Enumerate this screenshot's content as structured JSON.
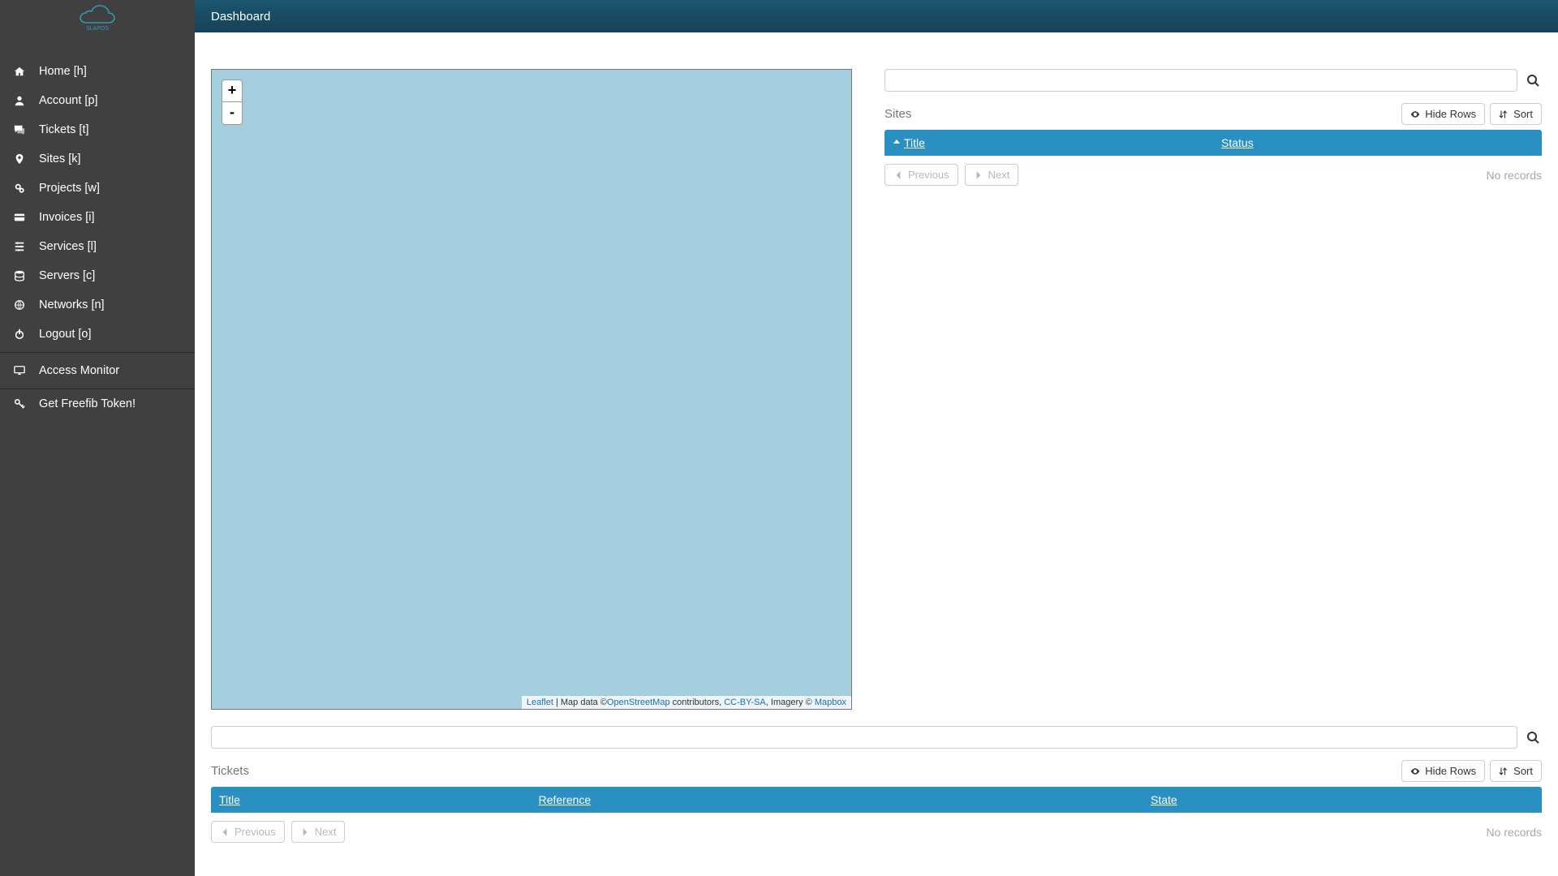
{
  "brand": "SLAPOS",
  "header": {
    "title": "Dashboard"
  },
  "sidebar": {
    "items": [
      {
        "label": "Home [h]",
        "icon": "home-icon"
      },
      {
        "label": "Account [p]",
        "icon": "user-icon"
      },
      {
        "label": "Tickets [t]",
        "icon": "comments-icon"
      },
      {
        "label": "Sites [k]",
        "icon": "marker-icon"
      },
      {
        "label": "Projects [w]",
        "icon": "gears-icon"
      },
      {
        "label": "Invoices [i]",
        "icon": "card-icon"
      },
      {
        "label": "Services [l]",
        "icon": "sliders-icon"
      },
      {
        "label": "Servers [c]",
        "icon": "database-icon"
      },
      {
        "label": "Networks [n]",
        "icon": "globe-icon"
      },
      {
        "label": "Logout [o]",
        "icon": "power-icon"
      }
    ],
    "monitor": {
      "label": "Access Monitor",
      "icon": "monitor-icon"
    },
    "token": {
      "label": "Get Freefib Token!",
      "icon": "key-icon"
    }
  },
  "map": {
    "zoom_in": "+",
    "zoom_out": "-",
    "attribution": {
      "leaflet": "Leaflet",
      "prefix": " | Map data ©",
      "osm": "OpenStreetMap",
      "contrib": " contributors, ",
      "cc": "CC-BY-SA",
      "imagery": ", Imagery © ",
      "mapbox": "Mapbox"
    }
  },
  "buttons": {
    "hide_rows": "Hide Rows",
    "sort": "Sort",
    "previous": "Previous",
    "next": "Next"
  },
  "sites": {
    "title": "Sites",
    "columns": {
      "title": "Title",
      "status": "Status"
    },
    "empty": "No records",
    "search_placeholder": ""
  },
  "tickets": {
    "title": "Tickets",
    "columns": {
      "title": "Title",
      "reference": "Reference",
      "state": "State"
    },
    "empty": "No records",
    "search_placeholder": ""
  }
}
